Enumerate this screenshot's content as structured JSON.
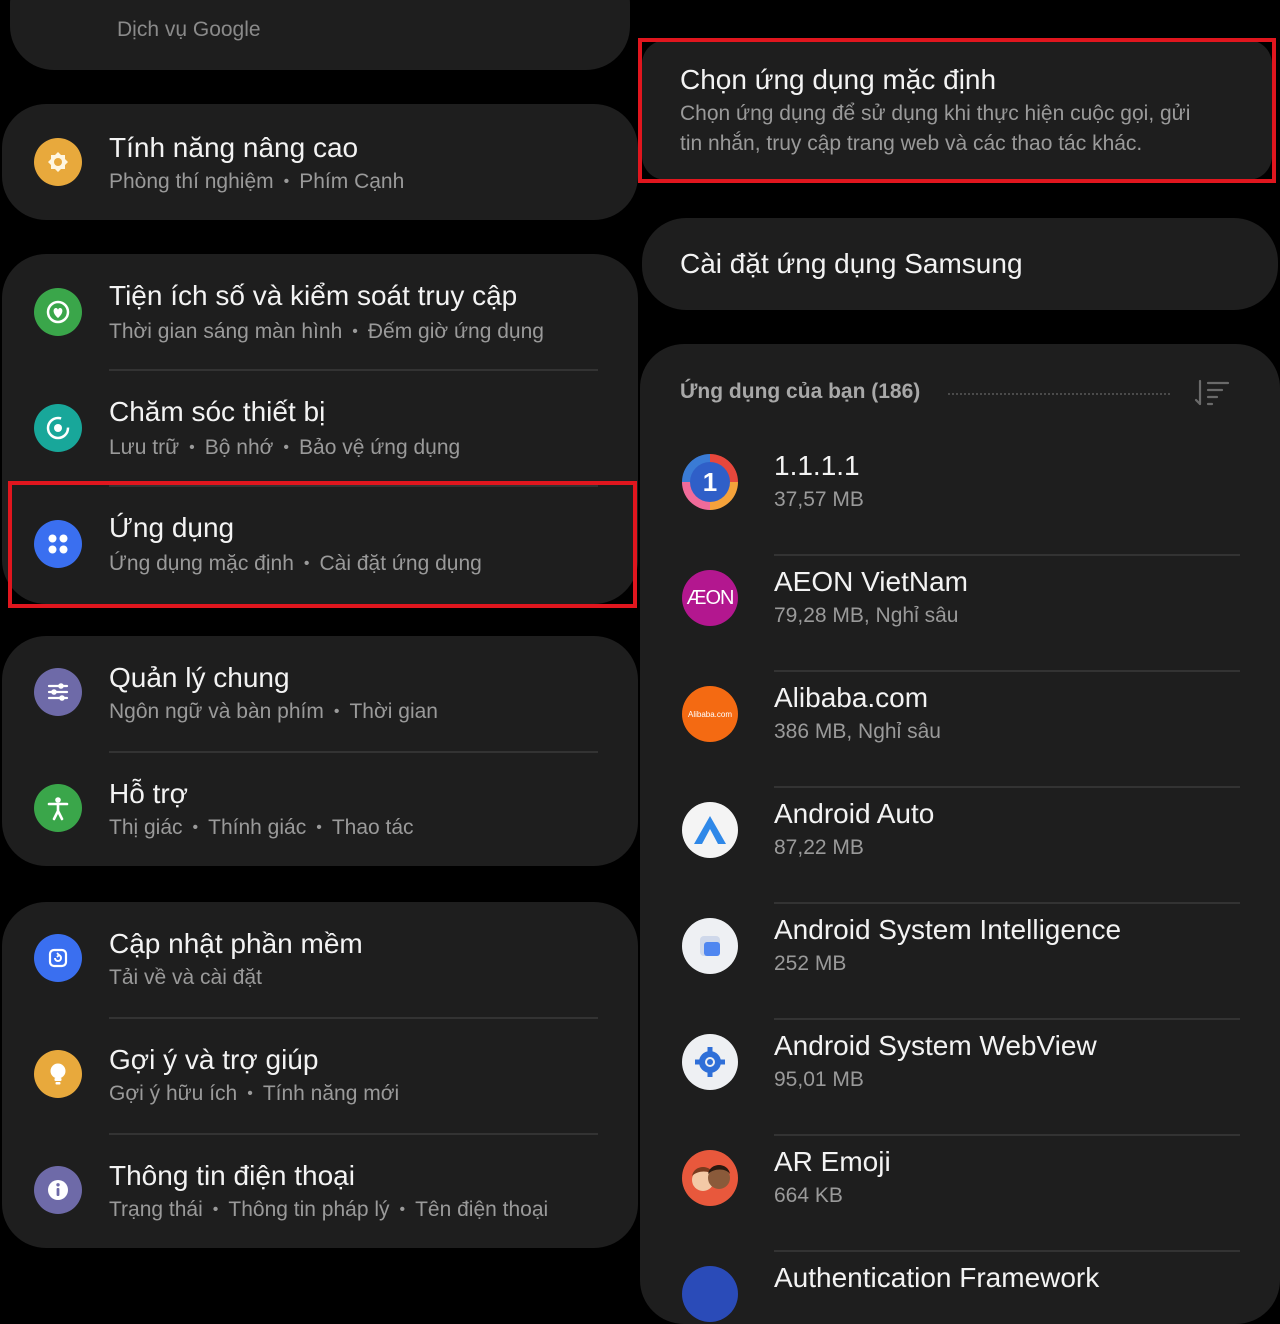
{
  "left": {
    "top_partial": "Dịch vụ Google",
    "items": [
      {
        "title": "Tính năng nâng cao",
        "subs": [
          "Phòng thí nghiệm",
          "Phím Cạnh"
        ],
        "icon": "advanced-features-icon",
        "color": "#e8a93c"
      },
      {
        "title": "Tiện ích số và kiểm soát truy cập",
        "subs": [
          "Thời gian sáng màn hình",
          "Đếm giờ ứng dụng"
        ],
        "icon": "digital-wellbeing-icon",
        "color": "#3aa64a"
      },
      {
        "title": "Chăm sóc thiết bị",
        "subs": [
          "Lưu trữ",
          "Bộ nhớ",
          "Bảo vệ ứng dụng"
        ],
        "icon": "device-care-icon",
        "color": "#18a79a"
      },
      {
        "title": "Ứng dụng",
        "subs": [
          "Ứng dụng mặc định",
          "Cài đặt ứng dụng"
        ],
        "icon": "apps-icon",
        "color": "#3a6ff0"
      },
      {
        "title": "Quản lý chung",
        "subs": [
          "Ngôn ngữ và bàn phím",
          "Thời gian"
        ],
        "icon": "general-management-icon",
        "color": "#6e6aa8"
      },
      {
        "title": "Hỗ trợ",
        "subs": [
          "Thị giác",
          "Thính giác",
          "Thao tác"
        ],
        "icon": "accessibility-icon",
        "color": "#3aa64a"
      },
      {
        "title": "Cập nhật phần mềm",
        "subs": [
          "Tải về và cài đặt"
        ],
        "icon": "software-update-icon",
        "color": "#3a6ff0"
      },
      {
        "title": "Gợi ý và trợ giúp",
        "subs": [
          "Gợi ý hữu ích",
          "Tính năng mới"
        ],
        "icon": "tips-icon",
        "color": "#e8a93c"
      },
      {
        "title": "Thông tin điện thoại",
        "subs": [
          "Trạng thái",
          "Thông tin pháp lý",
          "Tên điện thoại"
        ],
        "icon": "about-phone-icon",
        "color": "#6e6aa8"
      }
    ]
  },
  "right": {
    "default_apps": {
      "title": "Chọn ứng dụng mặc định",
      "desc1": "Chọn ứng dụng để sử dụng khi thực hiện cuộc gọi, gửi",
      "desc2": "tin nhắn, truy cập trang web và các thao tác khác."
    },
    "samsung_settings": "Cài đặt ứng dụng Samsung",
    "list_header": "Ứng dụng của bạn (186)",
    "apps": [
      {
        "name": "1.1.1.1",
        "size": "37,57 MB",
        "icon": "cloudflare-1111-icon"
      },
      {
        "name": "AEON VietNam",
        "size": "79,28 MB, Nghỉ sâu",
        "icon": "aeon-icon",
        "glyph": "ÆON"
      },
      {
        "name": "Alibaba.com",
        "size": "386 MB, Nghỉ sâu",
        "icon": "alibaba-icon",
        "glyph": "Alibaba.com"
      },
      {
        "name": "Android Auto",
        "size": "87,22 MB",
        "icon": "android-auto-icon"
      },
      {
        "name": "Android System Intelligence",
        "size": "252 MB",
        "icon": "android-system-intelligence-icon"
      },
      {
        "name": "Android System WebView",
        "size": "95,01 MB",
        "icon": "android-webview-icon"
      },
      {
        "name": "AR Emoji",
        "size": "664 KB",
        "icon": "ar-emoji-icon"
      },
      {
        "name": "Authentication Framework",
        "size": "",
        "icon": "authentication-framework-icon"
      }
    ]
  }
}
